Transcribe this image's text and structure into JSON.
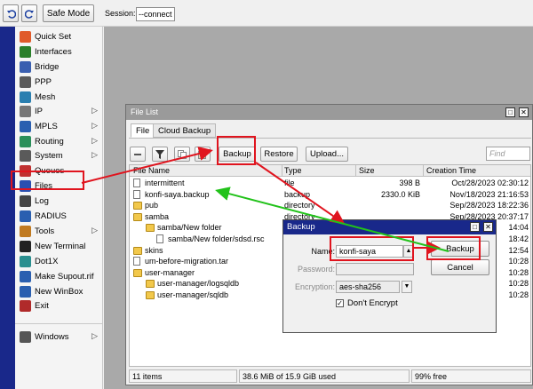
{
  "toolbar": {
    "undo_icon": "undo-icon",
    "redo_icon": "redo-icon",
    "safe_mode_label": "Safe Mode",
    "session_label": "Session:",
    "session_value": "--connect"
  },
  "sidebar": {
    "items": [
      {
        "label": "Quick Set",
        "icon": "quick-set-icon",
        "submenu": false
      },
      {
        "label": "Interfaces",
        "icon": "interfaces-icon",
        "submenu": false
      },
      {
        "label": "Bridge",
        "icon": "bridge-icon",
        "submenu": false
      },
      {
        "label": "PPP",
        "icon": "ppp-icon",
        "submenu": false
      },
      {
        "label": "Mesh",
        "icon": "mesh-icon",
        "submenu": false
      },
      {
        "label": "IP",
        "icon": "ip-icon",
        "submenu": true
      },
      {
        "label": "MPLS",
        "icon": "mpls-icon",
        "submenu": true
      },
      {
        "label": "Routing",
        "icon": "routing-icon",
        "submenu": true
      },
      {
        "label": "System",
        "icon": "system-icon",
        "submenu": true
      },
      {
        "label": "Queues",
        "icon": "queues-icon",
        "submenu": false
      },
      {
        "label": "Files",
        "icon": "files-icon",
        "submenu": false
      },
      {
        "label": "Log",
        "icon": "log-icon",
        "submenu": false
      },
      {
        "label": "RADIUS",
        "icon": "radius-icon",
        "submenu": false
      },
      {
        "label": "Tools",
        "icon": "tools-icon",
        "submenu": true
      },
      {
        "label": "New Terminal",
        "icon": "terminal-icon",
        "submenu": false
      },
      {
        "label": "Dot1X",
        "icon": "dot1x-icon",
        "submenu": false
      },
      {
        "label": "Make Supout.rif",
        "icon": "supout-icon",
        "submenu": false
      },
      {
        "label": "New WinBox",
        "icon": "winbox-icon",
        "submenu": false
      },
      {
        "label": "Exit",
        "icon": "exit-icon",
        "submenu": false
      },
      {
        "label": "Windows",
        "icon": "windows-icon",
        "submenu": true
      }
    ]
  },
  "file_list": {
    "title": "File List",
    "tabs": [
      "File",
      "Cloud Backup"
    ],
    "toolbar": {
      "remove_icon": "minus-icon",
      "filter_icon": "filter-icon",
      "copy_icon": "copy-icon",
      "paste_icon": "paste-icon",
      "backup_label": "Backup",
      "restore_label": "Restore",
      "upload_label": "Upload...",
      "find_placeholder": "Find"
    },
    "columns": [
      "File Name",
      "Type",
      "Size",
      "Creation Time"
    ],
    "rows": [
      {
        "name": "intermittent",
        "type": "file",
        "size": "398 B",
        "time": "Oct/28/2023 02:30:12",
        "icon": "file"
      },
      {
        "name": "konfi-saya.backup",
        "type": "backup",
        "size": "2330.0 KiB",
        "time": "Nov/18/2023 21:16:53",
        "icon": "file"
      },
      {
        "name": "pub",
        "type": "directory",
        "size": "",
        "time": "Sep/28/2023 18:22:36",
        "icon": "folder"
      },
      {
        "name": "samba",
        "type": "directory",
        "size": "",
        "time": "Sep/28/2023 20:37:17",
        "icon": "folder"
      },
      {
        "name": "samba/New folder",
        "type": "",
        "size": "",
        "time": "14:04",
        "icon": "folder"
      },
      {
        "name": "samba/New folder/sdsd.rsc",
        "type": "",
        "size": "",
        "time": "18:42",
        "icon": "file"
      },
      {
        "name": "skins",
        "type": "",
        "size": "",
        "time": "12:54",
        "icon": "folder"
      },
      {
        "name": "um-before-migration.tar",
        "type": "",
        "size": "",
        "time": "10:28",
        "icon": "file"
      },
      {
        "name": "user-manager",
        "type": "",
        "size": "",
        "time": "10:28",
        "icon": "folder"
      },
      {
        "name": "user-manager/logsqldb",
        "type": "",
        "size": "",
        "time": "10:28",
        "icon": "folder"
      },
      {
        "name": "user-manager/sqldb",
        "type": "",
        "size": "",
        "time": "10:28",
        "icon": "folder"
      }
    ],
    "status": {
      "count": "11 items",
      "usage": "38.6 MiB of 15.9 GiB used",
      "free": "99% free"
    }
  },
  "backup_dialog": {
    "title": "Backup",
    "name_label": "Name:",
    "name_value": "konfi-saya",
    "password_label": "Password:",
    "password_value": "",
    "encryption_label": "Encryption:",
    "encryption_value": "aes-sha256",
    "dont_encrypt_label": "Don't Encrypt",
    "dont_encrypt_checked": true,
    "backup_button": "Backup",
    "cancel_button": "Cancel"
  },
  "colors": {
    "annotation_red": "#e0141e",
    "annotation_green": "#22c21a",
    "active_title": "#19288a",
    "desktop": "#a9a9a9"
  }
}
